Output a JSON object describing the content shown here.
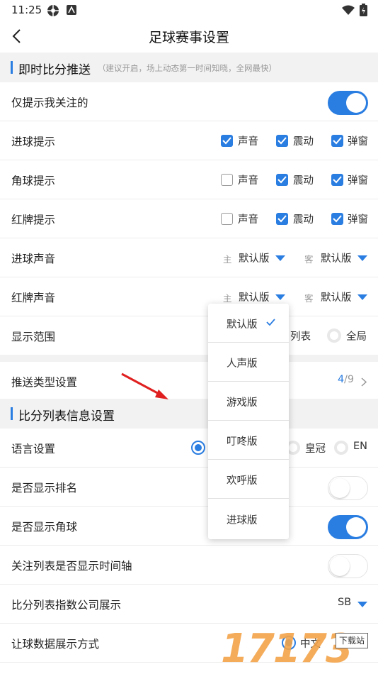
{
  "status_bar": {
    "time": "11:25"
  },
  "header": {
    "title": "足球赛事设置"
  },
  "section1": {
    "title": "即时比分推送",
    "hint": "（建议开启，场上动态第一时间知晓，全网最快）"
  },
  "rows": {
    "only_followed": {
      "label": "仅提示我关注的",
      "enabled": true
    },
    "goal_alert": {
      "label": "进球提示",
      "sound": "声音",
      "vibrate": "震动",
      "popup": "弹窗",
      "sound_checked": true,
      "vibrate_checked": true,
      "popup_checked": true
    },
    "corner_alert": {
      "label": "角球提示",
      "sound": "声音",
      "vibrate": "震动",
      "popup": "弹窗",
      "sound_checked": false,
      "vibrate_checked": true,
      "popup_checked": true
    },
    "red_card_alert": {
      "label": "红牌提示",
      "sound": "声音",
      "vibrate": "震动",
      "popup": "弹窗",
      "sound_checked": false,
      "vibrate_checked": true,
      "popup_checked": true
    },
    "goal_sound": {
      "label": "进球声音",
      "home_tag": "主",
      "home_value": "默认版",
      "away_tag": "客",
      "away_value": "默认版"
    },
    "red_card_sound": {
      "label": "红牌声音",
      "home_tag": "主",
      "home_value": "默认版",
      "away_tag": "客",
      "away_value": "默认版"
    },
    "display_range": {
      "label": "显示范围",
      "option_list": "列表",
      "option_global": "全局"
    },
    "push_types": {
      "label": "推送类型设置",
      "selected_count": "4",
      "total": "/9"
    }
  },
  "section2": {
    "title": "比分列表信息设置"
  },
  "rows2": {
    "language": {
      "label": "语言设置",
      "option_hk": "皇冠",
      "option_en": "EN"
    },
    "show_rank": {
      "label": "是否显示排名",
      "enabled": false
    },
    "show_corner": {
      "label": "是否显示角球",
      "enabled": true
    },
    "timeline": {
      "label": "关注列表是否显示时间轴",
      "enabled": false
    },
    "odds_company": {
      "label": "比分列表指数公司展示",
      "value": "SB"
    },
    "handicap_mode": {
      "label": "让球数据展示方式",
      "value": "中文"
    }
  },
  "dropdown": {
    "items": [
      "默认版",
      "人声版",
      "游戏版",
      "叮咚版",
      "欢呼版",
      "进球版"
    ],
    "selected": "默认版"
  },
  "watermark": {
    "logo": "17173",
    "badge": "下载站"
  },
  "colors": {
    "accent": "#2a7de1",
    "section_bg": "#f2f2f2",
    "arrow": "#e02020"
  }
}
